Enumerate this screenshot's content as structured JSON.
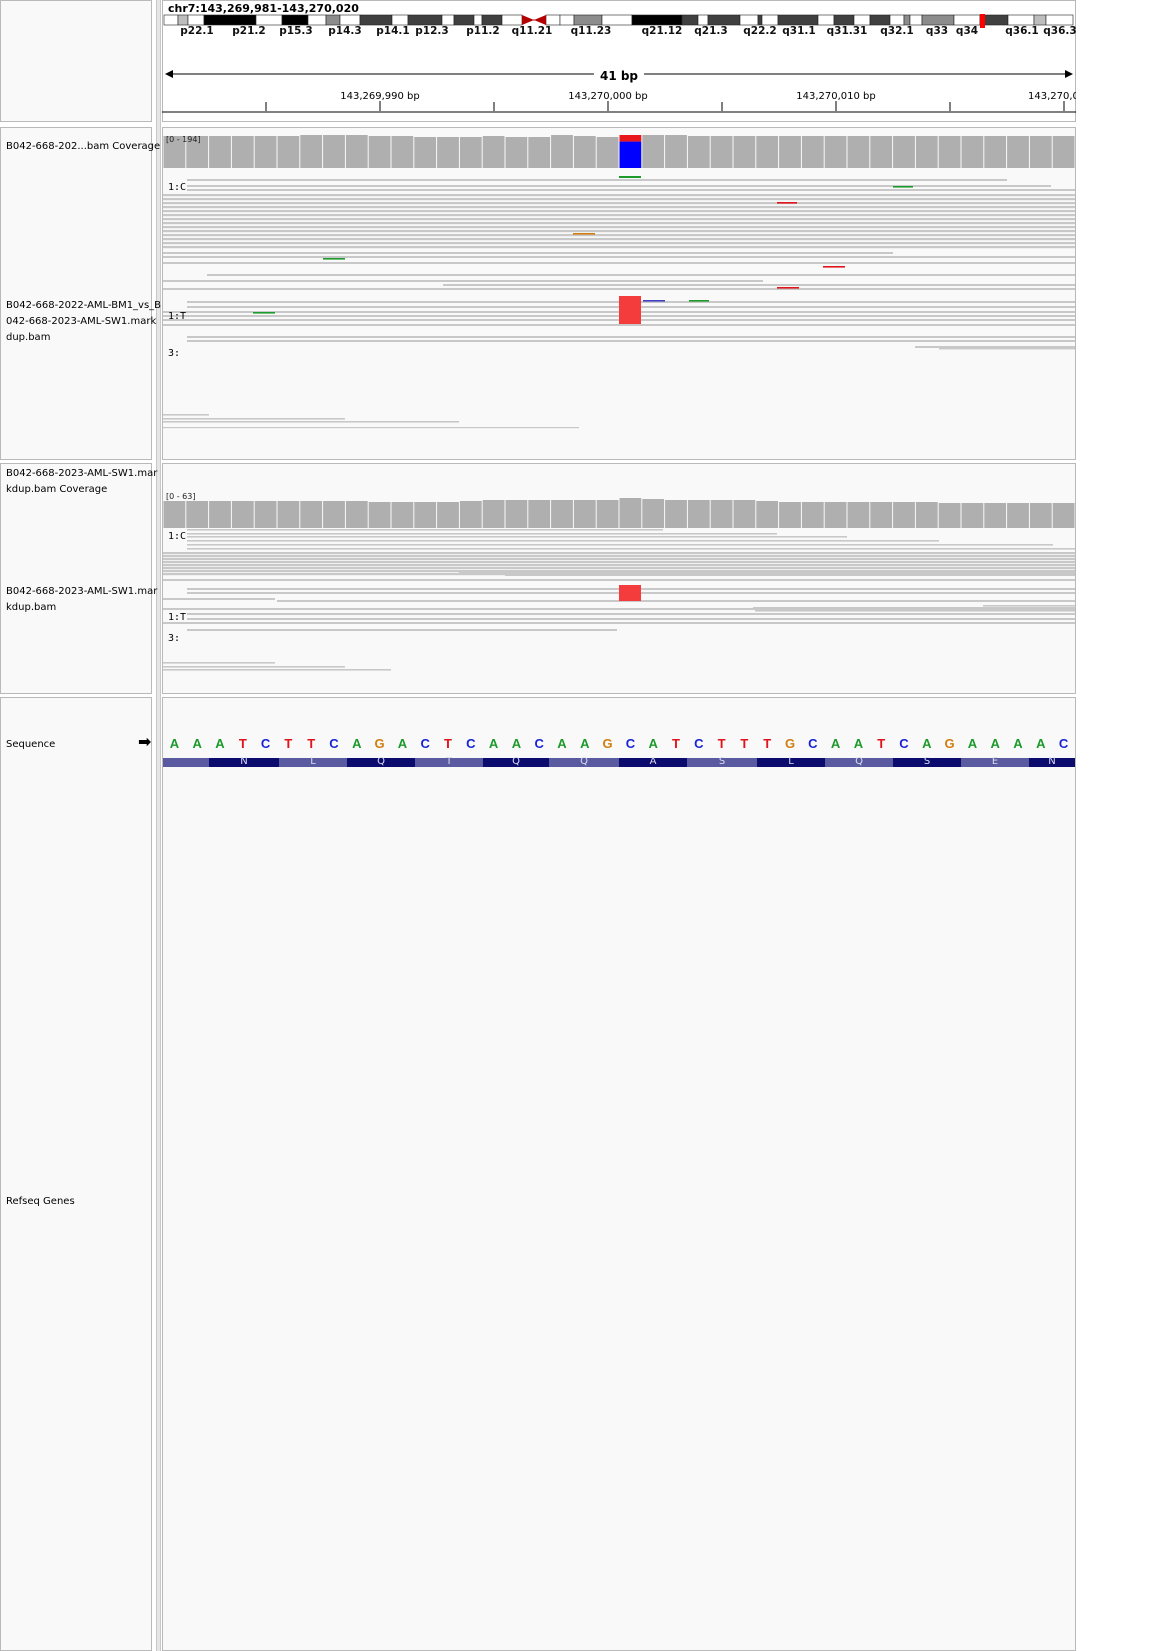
{
  "locus": "chr7:143,269,981-143,270,020",
  "ideogram_bands": [
    "p22.1",
    "p21.2",
    "p15.3",
    "p14.3",
    "p14.1",
    "p12.3",
    "p11.2",
    "q11.21",
    "q11.23",
    "q21.12",
    "q21.3",
    "q22.2",
    "q31.1",
    "q31.31",
    "q32.1",
    "q33",
    "q34",
    "q36.1",
    "q36.3"
  ],
  "span_label": "41 bp",
  "ruler_ticks": [
    "143,269,990 bp",
    "143,270,000 bp",
    "143,270,010 bp",
    "143,270,0"
  ],
  "tracks": {
    "bam1_coverage_label": "B042-668-202...bam Coverage",
    "bam1_coverage_range": "[0 - 194]",
    "bam1_alignment_label": "B042-668-2022-AML-BM1_vs_B042-668-2023-AML-SW1.markdup.bam",
    "bam1_group1": "1:C",
    "bam1_group2": "1:T",
    "bam1_group3": "3:",
    "bam2_coverage_label": "B042-668-2023-AML-SW1.markdup.bam Coverage",
    "bam2_coverage_range": "[0 - 63]",
    "bam2_alignment_label": "B042-668-2023-AML-SW1.markdup.bam",
    "bam2_group1": "1:C",
    "bam2_group2": "1:T",
    "bam2_group3": "3:",
    "sequence_label": "Sequence",
    "sequence_arrow": "➡",
    "refseq_label": "Refseq Genes"
  },
  "sequence": [
    "A",
    "A",
    "A",
    "T",
    "C",
    "T",
    "T",
    "C",
    "A",
    "G",
    "A",
    "C",
    "T",
    "C",
    "A",
    "A",
    "C",
    "A",
    "A",
    "G",
    "C",
    "A",
    "T",
    "C",
    "T",
    "T",
    "T",
    "G",
    "C",
    "A",
    "A",
    "T",
    "C",
    "A",
    "G",
    "A",
    "A",
    "A",
    "A",
    "C"
  ],
  "amino_acids": [
    "N",
    "L",
    "Q",
    "T",
    "Q",
    "Q",
    "A",
    "S",
    "L",
    "Q",
    "S",
    "E",
    "N"
  ],
  "base_colors": {
    "A": "#1c9a2a",
    "C": "#1a23d4",
    "G": "#d17d10",
    "T": "#e0141a"
  },
  "variant_colors": {
    "ref_C": "#0000ff",
    "alt_T": "#e8151b",
    "alt_box": "#f43c3c"
  }
}
